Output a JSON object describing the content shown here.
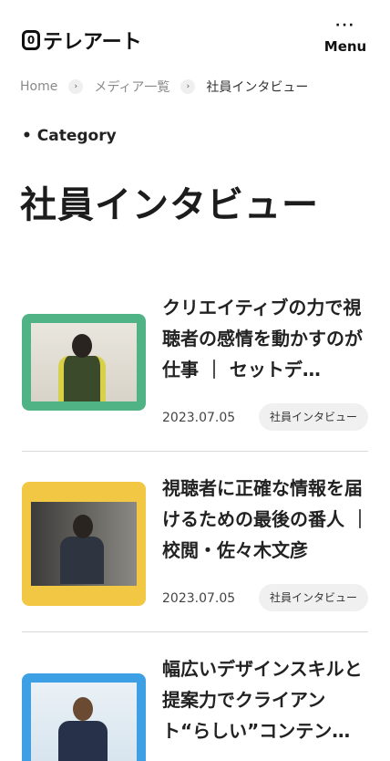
{
  "header": {
    "logo_text": "テレアート",
    "menu_dots": "···",
    "menu_label": "Menu"
  },
  "breadcrumb": {
    "home": "Home",
    "media": "メディア一覧",
    "current": "社員インタビュー",
    "separator": "›"
  },
  "category": {
    "label": "• Category",
    "title": "社員インタビュー"
  },
  "articles": [
    {
      "title": "クリエイティブの力で視聴者の感情を動かすのが仕事 ｜ セットデ…",
      "date": "2023.07.05",
      "tag": "社員インタビュー",
      "thumb_color": "#4fb385"
    },
    {
      "title": "視聴者に正確な情報を届けるための最後の番人 ｜ 校閲・佐々木文彦",
      "date": "2023.07.05",
      "tag": "社員インタビュー",
      "thumb_color": "#f2c744"
    },
    {
      "title": "幅広いデザインスキルと提案力でクライアント“らしい”コンテン…",
      "thumb_color": "#3d9fe4"
    }
  ]
}
